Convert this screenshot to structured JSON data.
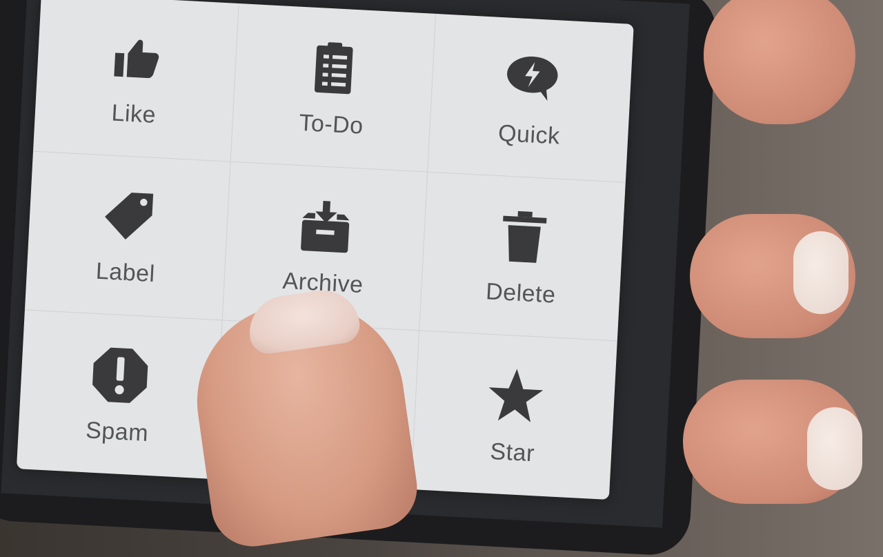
{
  "menu": {
    "items": [
      {
        "label": "Like",
        "icon": "thumbs-up-icon"
      },
      {
        "label": "To-Do",
        "icon": "clipboard-list-icon"
      },
      {
        "label": "Quick",
        "icon": "speech-bubble-bolt-icon"
      },
      {
        "label": "Label",
        "icon": "tag-icon"
      },
      {
        "label": "Archive",
        "icon": "archive-box-icon"
      },
      {
        "label": "Delete",
        "icon": "trash-icon"
      },
      {
        "label": "Spam",
        "icon": "spam-octagon-icon"
      },
      {
        "label": "",
        "icon": "hidden-by-finger"
      },
      {
        "label": "Star",
        "icon": "star-icon"
      }
    ]
  },
  "colors": {
    "panel_bg": "#e3e4e6",
    "icon": "#3a3a3c",
    "label": "#545456"
  }
}
